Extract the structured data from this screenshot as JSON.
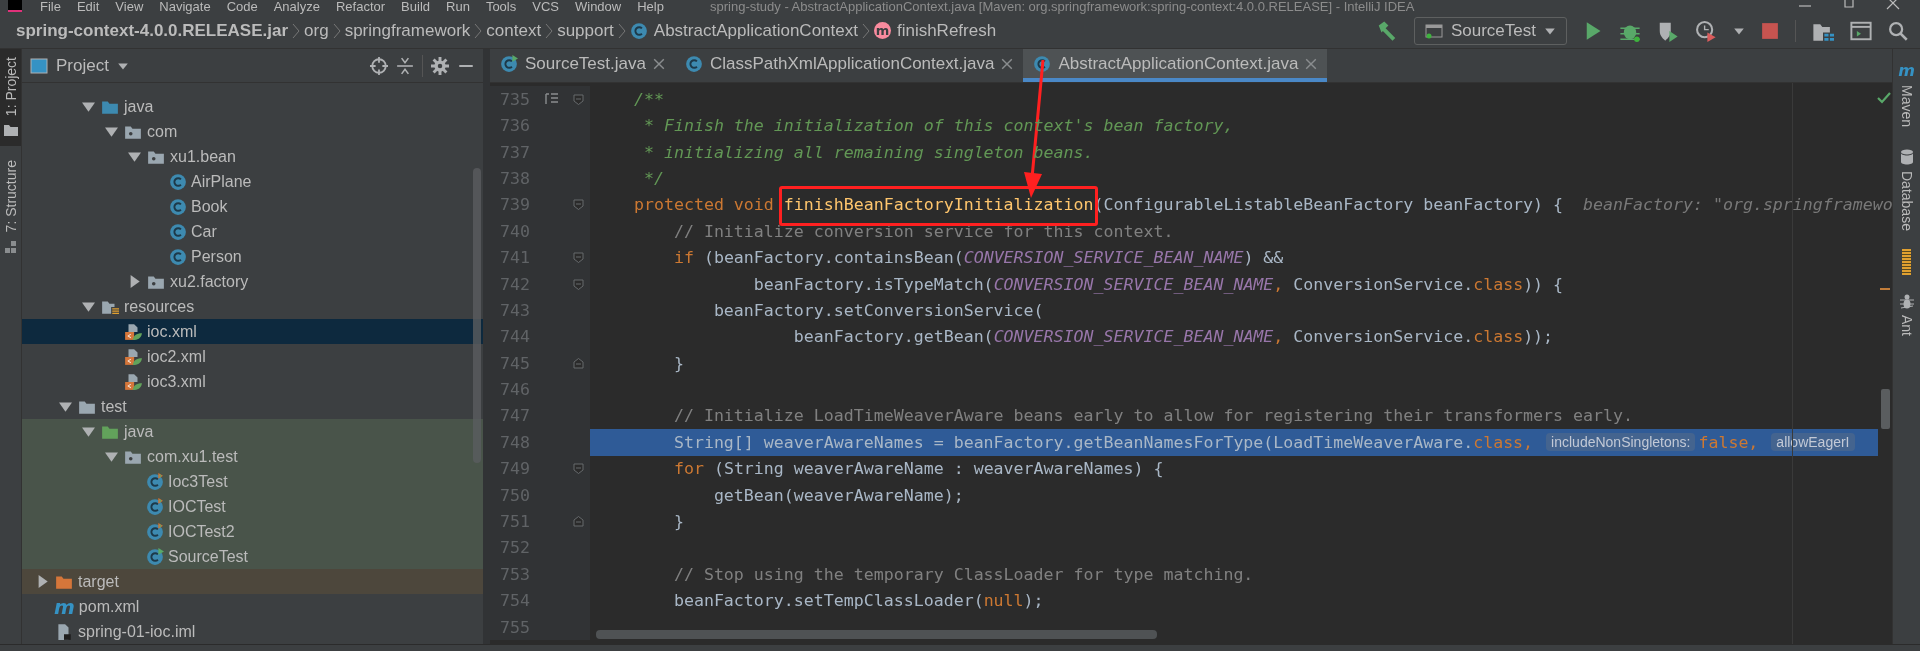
{
  "menu": [
    "File",
    "Edit",
    "View",
    "Navigate",
    "Code",
    "Analyze",
    "Refactor",
    "Build",
    "Run",
    "Tools",
    "VCS",
    "Window",
    "Help"
  ],
  "window_title": "spring-study - AbstractApplicationContext.java [Maven: org.springframework:spring-context:4.0.0.RELEASE] - IntelliJ IDEA",
  "breadcrumbs": [
    {
      "kind": "jar",
      "text": "spring-context-4.0.0.RELEASE.jar"
    },
    {
      "kind": "package",
      "text": "org"
    },
    {
      "kind": "package",
      "text": "springframework"
    },
    {
      "kind": "package",
      "text": "context"
    },
    {
      "kind": "package",
      "text": "support"
    },
    {
      "kind": "class",
      "text": "AbstractApplicationContext"
    },
    {
      "kind": "method",
      "text": "finishRefresh",
      "glyph": "m"
    }
  ],
  "run_config": {
    "text": "SourceTest"
  },
  "left_stripe": [
    {
      "label": "1: Project",
      "kind": "project",
      "selected": true
    },
    {
      "label": "7: Structure",
      "kind": "structure",
      "selected": false
    }
  ],
  "right_stripe": [
    {
      "label": "Maven",
      "kind": "maven",
      "glyph": "m"
    },
    {
      "label": "Database",
      "kind": "database"
    },
    {
      "label": "Ant",
      "kind": "ant"
    }
  ],
  "project_panel": {
    "title": "Project",
    "tree": [
      {
        "children": [
          {
            "children": [
              {
                "label": "java",
                "kind": "source-folder",
                "expanded": true,
                "selected": false,
                "children": [
                  {
                    "label": "com",
                    "kind": "package",
                    "expanded": true,
                    "selected": false,
                    "children": [
                      {
                        "label": "xu1.bean",
                        "kind": "package",
                        "expanded": true,
                        "selected": false,
                        "children": [
                          {
                            "label": "AirPlane",
                            "kind": "class",
                            "selected": false
                          },
                          {
                            "label": "Book",
                            "kind": "class",
                            "selected": false
                          },
                          {
                            "label": "Car",
                            "kind": "class",
                            "selected": false
                          },
                          {
                            "label": "Person",
                            "kind": "class",
                            "selected": false
                          }
                        ]
                      },
                      {
                        "label": "xu2.factory",
                        "kind": "package",
                        "expanded": false,
                        "selected": false
                      }
                    ]
                  }
                ]
              },
              {
                "label": "resources",
                "kind": "resources-folder",
                "expanded": true,
                "selected": false,
                "children": [
                  {
                    "label": "ioc.xml",
                    "kind": "spring-xml",
                    "selected": true
                  },
                  {
                    "label": "ioc2.xml",
                    "kind": "spring-xml",
                    "selected": false
                  },
                  {
                    "label": "ioc3.xml",
                    "kind": "spring-xml",
                    "selected": false
                  }
                ]
              }
            ]
          },
          {
            "label": "test",
            "kind": "folder",
            "expanded": true,
            "selected": false,
            "children": [
              {
                "label": "java",
                "kind": "test-folder",
                "expanded": true,
                "selected": false,
                "children": [
                  {
                    "label": "com.xu1.test",
                    "kind": "package",
                    "expanded": true,
                    "selected": false,
                    "children": [
                      {
                        "label": "Ioc3Test",
                        "kind": "test-class",
                        "selected": false
                      },
                      {
                        "label": "IOCTest",
                        "kind": "test-class",
                        "selected": false
                      },
                      {
                        "label": "IOCTest2",
                        "kind": "test-class",
                        "selected": false
                      },
                      {
                        "label": "SourceTest",
                        "kind": "runnable-class",
                        "selected": false
                      }
                    ]
                  }
                ]
              }
            ]
          }
        ]
      },
      {
        "label": "target",
        "kind": "excluded-folder",
        "expanded": false,
        "selected": false
      },
      {
        "label": "pom.xml",
        "kind": "maven",
        "glyph": "m",
        "selected": false
      },
      {
        "label": "spring-01-ioc.iml",
        "kind": "iml",
        "selected": false
      }
    ]
  },
  "tabs": [
    {
      "label": "SourceTest.java",
      "kind": "runnable-class",
      "selected": false
    },
    {
      "label": "ClassPathXmlApplicationContext.java",
      "kind": "class",
      "selected": false
    },
    {
      "label": "AbstractApplicationContext.java",
      "kind": "class",
      "selected": true
    }
  ],
  "code": [
    {
      "number": "735",
      "selected": false,
      "kind": "doc",
      "tokens": [
        {
          "kind": "doc",
          "text": "    /**"
        }
      ]
    },
    {
      "number": "736",
      "selected": false,
      "kind": "line",
      "tokens": [
        {
          "kind": "doc",
          "text": "     * Finish the initialization of this context's bean factory,"
        }
      ]
    },
    {
      "number": "737",
      "selected": false,
      "kind": "line",
      "tokens": [
        {
          "kind": "doc",
          "text": "     * initializing all remaining singleton beans."
        }
      ]
    },
    {
      "number": "738",
      "selected": false,
      "kind": "line",
      "tokens": [
        {
          "kind": "doc",
          "text": "     */"
        }
      ]
    },
    {
      "number": "739",
      "selected": false,
      "kind": "opener",
      "tokens": [
        {
          "kind": "keyword",
          "text": "    protected void "
        },
        {
          "kind": "marked",
          "text": "finishBeanFactoryInitialization"
        },
        {
          "kind": "plain",
          "text": "(ConfigurableListableBeanFactory beanFactory) {"
        },
        {
          "kind": "debug",
          "text": "  beanFactory: \"org.springframewo"
        }
      ]
    },
    {
      "number": "740",
      "selected": false,
      "kind": "line",
      "tokens": [
        {
          "kind": "comment",
          "text": "        // Initialize conversion service for this context."
        }
      ]
    },
    {
      "number": "741",
      "selected": false,
      "kind": "opener",
      "tokens": [
        {
          "kind": "keyword",
          "text": "        if"
        },
        {
          "kind": "plain",
          "text": " (beanFactory.containsBean("
        },
        {
          "kind": "constant",
          "text": "CONVERSION_SERVICE_BEAN_NAME"
        },
        {
          "kind": "plain",
          "text": ") &&"
        }
      ]
    },
    {
      "number": "742",
      "selected": false,
      "kind": "opener",
      "tokens": [
        {
          "kind": "plain",
          "text": "                beanFactory.isTypeMatch("
        },
        {
          "kind": "constant",
          "text": "CONVERSION_SERVICE_BEAN_NAME"
        },
        {
          "kind": "keyword",
          "text": ", "
        },
        {
          "kind": "plain",
          "text": "ConversionService."
        },
        {
          "kind": "keyword",
          "text": "class"
        },
        {
          "kind": "plain",
          "text": ")) {"
        }
      ]
    },
    {
      "number": "743",
      "selected": false,
      "kind": "line",
      "tokens": [
        {
          "kind": "plain",
          "text": "            beanFactory.setConversionService("
        }
      ]
    },
    {
      "number": "744",
      "selected": false,
      "kind": "line",
      "tokens": [
        {
          "kind": "plain",
          "text": "                    beanFactory.getBean("
        },
        {
          "kind": "constant",
          "text": "CONVERSION_SERVICE_BEAN_NAME"
        },
        {
          "kind": "keyword",
          "text": ", "
        },
        {
          "kind": "plain",
          "text": "ConversionService."
        },
        {
          "kind": "keyword",
          "text": "class"
        },
        {
          "kind": "plain",
          "text": "));"
        }
      ]
    },
    {
      "number": "745",
      "selected": false,
      "kind": "closer",
      "tokens": [
        {
          "kind": "plain",
          "text": "        }"
        }
      ]
    },
    {
      "number": "746",
      "selected": false,
      "kind": "line"
    },
    {
      "number": "747",
      "selected": false,
      "kind": "line",
      "tokens": [
        {
          "kind": "comment",
          "text": "        // Initialize LoadTimeWeaverAware beans early to allow for registering their transformers early."
        }
      ]
    },
    {
      "number": "748",
      "selected": true,
      "kind": "line",
      "tokens": [
        {
          "kind": "plain",
          "text": "        String[] weaverAwareNames = beanFactory.getBeanNamesForType(LoadTimeWeaverAware."
        },
        {
          "kind": "keyword",
          "text": "class, "
        },
        {
          "kind": "hint",
          "text": "includeNonSingletons:"
        },
        {
          "kind": "keyword",
          "text": "false, "
        },
        {
          "kind": "hint",
          "text": "allowEagerI"
        }
      ]
    },
    {
      "number": "749",
      "selected": false,
      "kind": "opener",
      "tokens": [
        {
          "kind": "keyword",
          "text": "        for"
        },
        {
          "kind": "plain",
          "text": " (String weaverAwareName : weaverAwareNames) {"
        }
      ]
    },
    {
      "number": "750",
      "selected": false,
      "kind": "line",
      "tokens": [
        {
          "kind": "plain",
          "text": "            getBean(weaverAwareName);"
        }
      ]
    },
    {
      "number": "751",
      "selected": false,
      "kind": "closer",
      "tokens": [
        {
          "kind": "plain",
          "text": "        }"
        }
      ]
    },
    {
      "number": "752",
      "selected": false,
      "kind": "line"
    },
    {
      "number": "753",
      "selected": false,
      "kind": "line",
      "tokens": [
        {
          "kind": "comment",
          "text": "        // Stop using the temporary ClassLoader for type matching."
        }
      ]
    },
    {
      "number": "754",
      "selected": false,
      "kind": "line",
      "tokens": [
        {
          "kind": "plain",
          "text": "        beanFactory.setTempClassLoader("
        },
        {
          "kind": "keyword",
          "text": "null"
        },
        {
          "kind": "plain",
          "text": ");"
        }
      ]
    },
    {
      "number": "755",
      "selected": false,
      "kind": "line"
    }
  ]
}
